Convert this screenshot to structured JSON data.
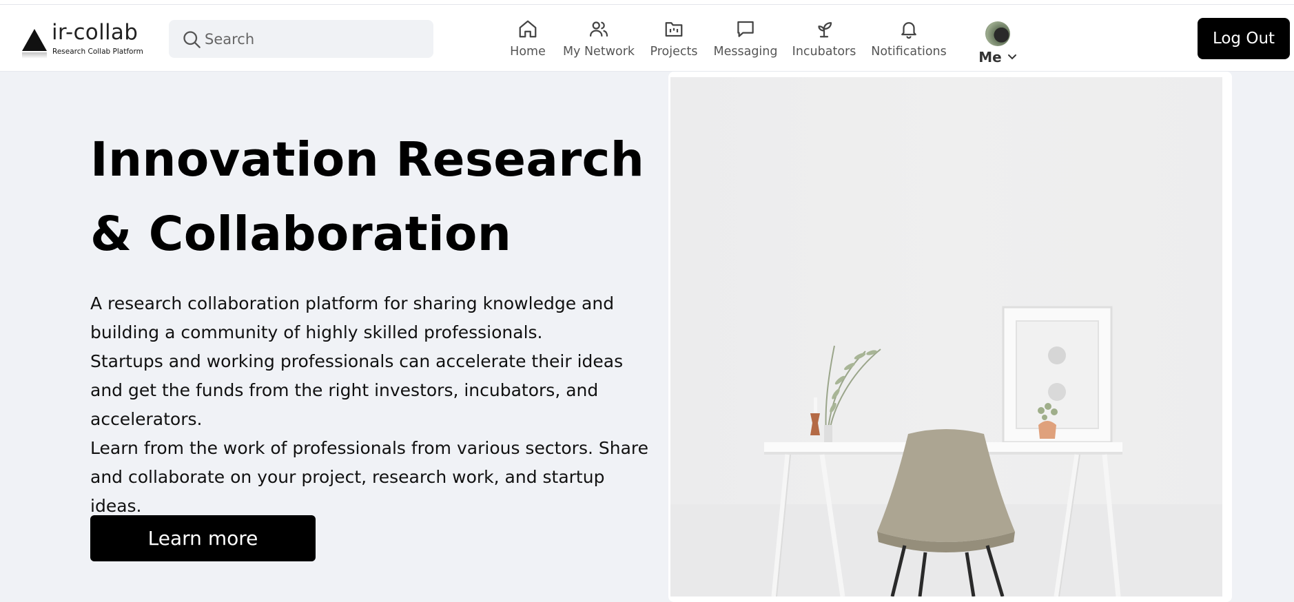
{
  "header": {
    "logo": {
      "name": "ir-collab",
      "tagline": "Research Collab Platform"
    },
    "search": {
      "placeholder": "Search",
      "value": ""
    },
    "nav": [
      {
        "label": "Home",
        "icon": "home-icon"
      },
      {
        "label": "My Network",
        "icon": "users-icon"
      },
      {
        "label": "Projects",
        "icon": "folder-icon"
      },
      {
        "label": "Messaging",
        "icon": "message-icon"
      },
      {
        "label": "Incubators",
        "icon": "sprout-icon"
      },
      {
        "label": "Notifications",
        "icon": "bell-icon"
      }
    ],
    "me": {
      "label": "Me",
      "icon": "chevron-down-icon"
    },
    "logout_label": "Log Out"
  },
  "hero": {
    "title_line1": "Innovation Research",
    "title_line2": "& Collaboration",
    "desc": [
      "A research collaboration platform for sharing knowledge and building a community of highly skilled professionals.",
      "Startups and working professionals can accelerate their ideas and get the funds from the right investors, incubators, and accelerators.",
      "Learn from the work of professionals from various sectors. Share and collaborate on your project, research work, and startup ideas."
    ],
    "cta_label": "Learn more"
  },
  "colors": {
    "accent": "#000000",
    "page_bg": "#f0f2f6",
    "header_bg": "#ffffff"
  }
}
